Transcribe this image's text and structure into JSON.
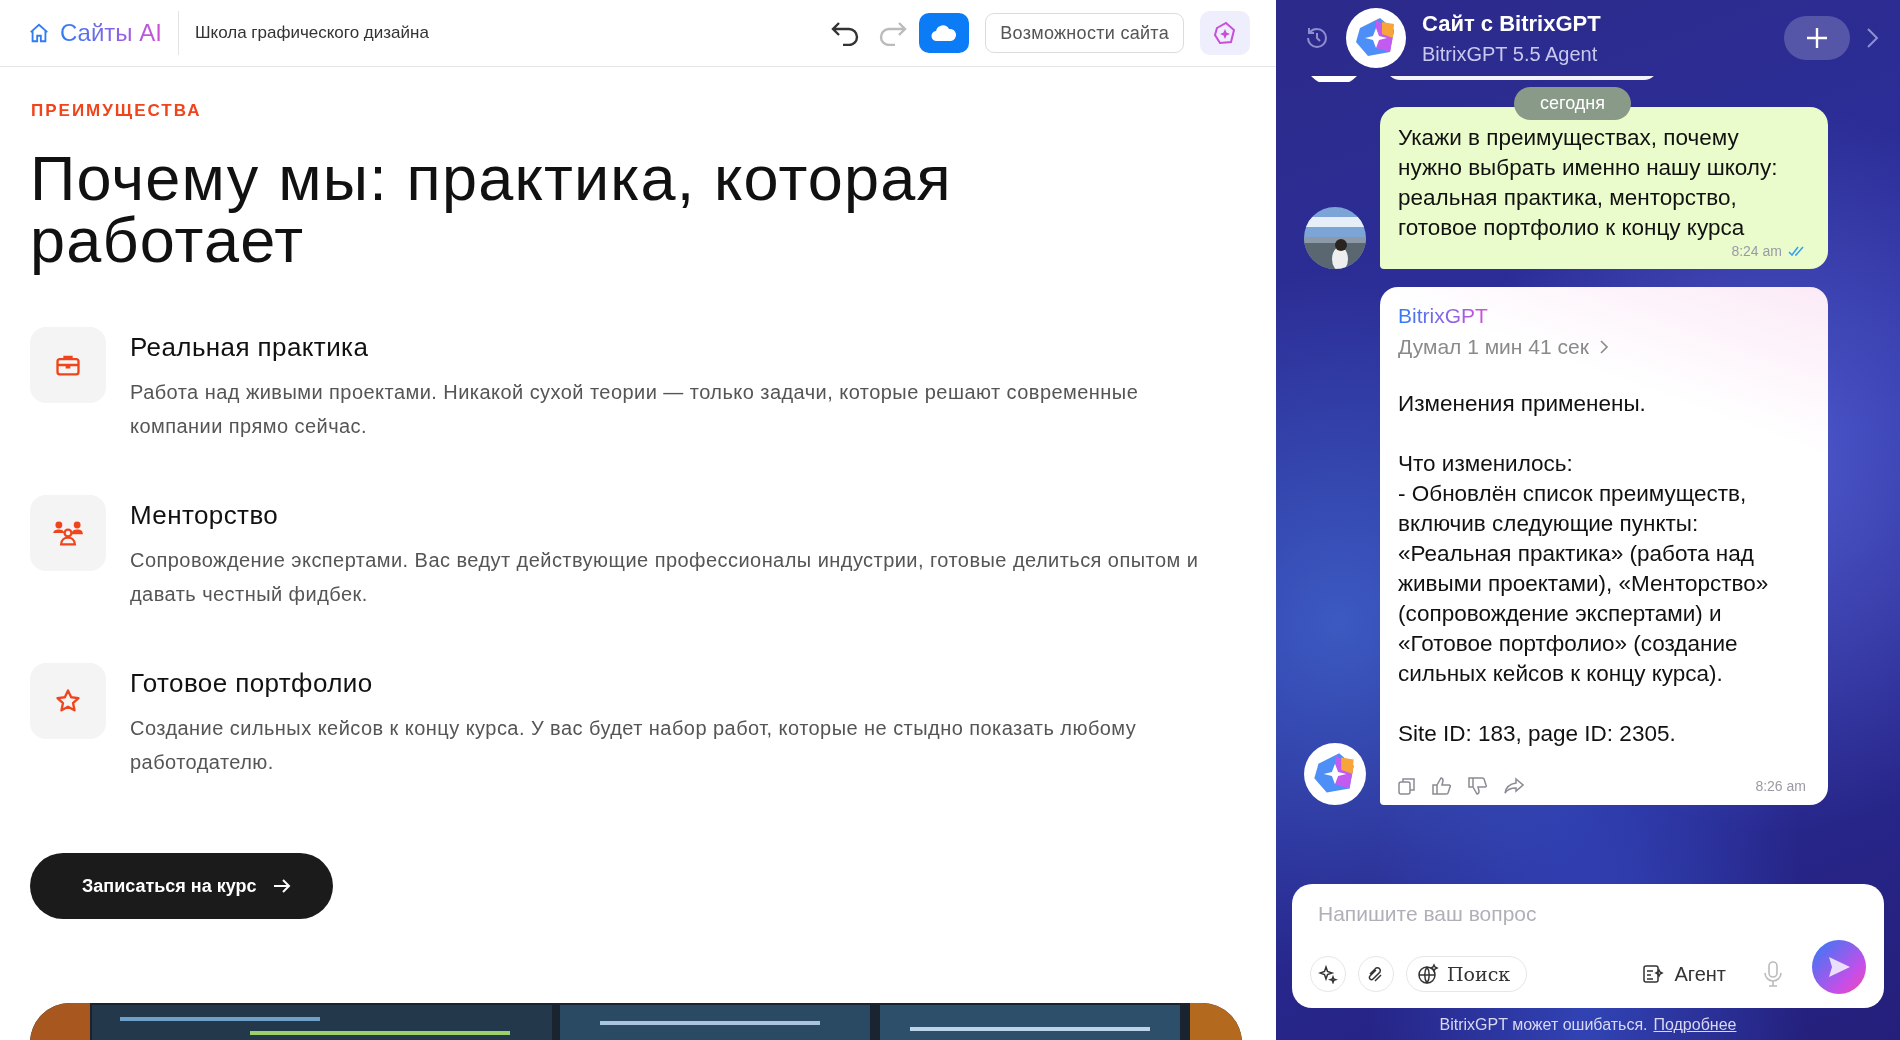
{
  "topbar": {
    "brand": "Сайты AI",
    "site_name": "Школа графического дизайна",
    "features_button": "Возможности сайта"
  },
  "section": {
    "eyebrow": "ПРЕИМУЩЕСТВА",
    "title": "Почему мы: практика, которая работает",
    "features": [
      {
        "kind": "briefcase",
        "title": "Реальная практика",
        "text": "Работа над живыми проектами. Никакой сухой теории — только задачи, которые решают современные компании прямо сейчас."
      },
      {
        "kind": "people",
        "title": "Менторство",
        "text": "Сопровождение экспертами. Вас ведут действующие профессионалы индустрии, готовые делиться опытом и давать честный фидбек."
      },
      {
        "kind": "star",
        "title": "Готовое портфолио",
        "text": "Создание сильных кейсов к концу курса. У вас будет набор работ, которые не стыдно показать любому работодателю."
      }
    ],
    "cta": "Записаться на курс"
  },
  "chat": {
    "title": "Сайт с BitrixGPT",
    "subtitle": "BitrixGPT 5.5 Agent",
    "date_divider": "сегодня",
    "messages": [
      {
        "kind": "user",
        "text": "Укажи в преимуществах, почему нужно выбрать именно нашу школу: реальная практика, менторство, готовое портфолио к концу курса",
        "time": "8:24 am",
        "read": true
      },
      {
        "kind": "bot",
        "author": "BitrixGPT",
        "thinking": "Думал 1 мин 41 сек",
        "paragraphs": [
          [
            "Изменения применены."
          ],
          [
            "Что изменилось:",
            "- Обновлён список преимуществ, включив следующие пункты: «Реальная практика» (работа над живыми проектами), «Менторство» (сопровождение экспертами) и «Готовое портфолио» (создание сильных кейсов к концу курса)."
          ],
          [
            "Site ID: 183, page ID: 2305."
          ]
        ],
        "time": "8:26 am"
      }
    ],
    "composer": {
      "placeholder": "Напишите ваш вопрос",
      "search_button": "Поиск",
      "agent_button": "Агент"
    },
    "disclaimer": "BitrixGPT может ошибаться.",
    "disclaimer_link": "Подробнее"
  }
}
